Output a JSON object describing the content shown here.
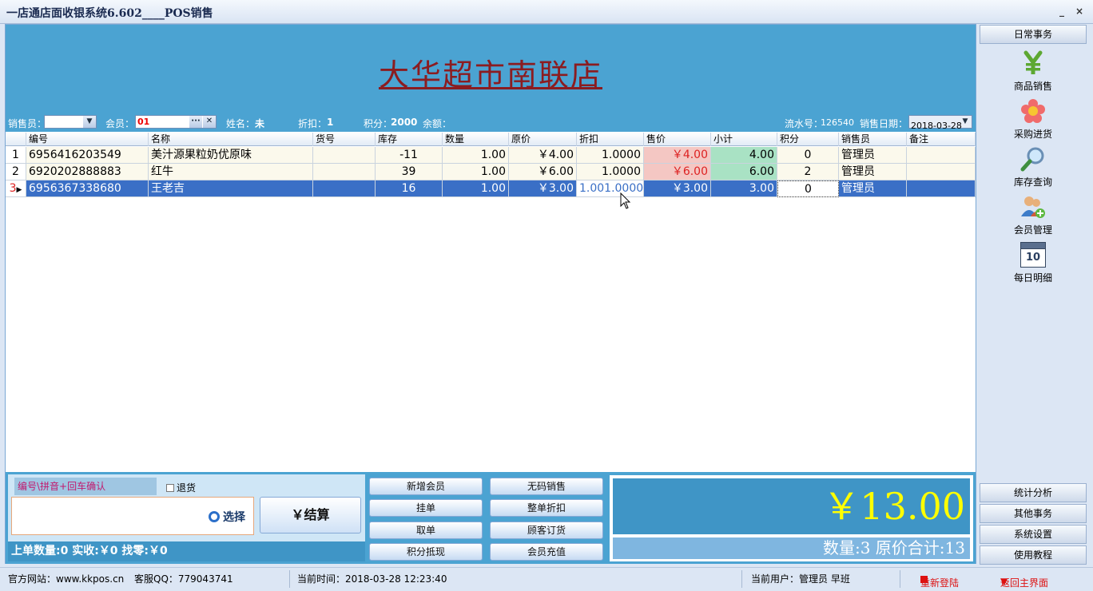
{
  "window": {
    "title": "一店通店面收银系统6.602____POS销售",
    "minimize": "_",
    "close": "×"
  },
  "banner": {
    "store_name": "大华超市南联店"
  },
  "info": {
    "salesman_label": "销售员：",
    "member_label": "会员：",
    "member_value": "01",
    "name_label": "姓名：",
    "name_value": "未",
    "discount_label": "折扣：",
    "discount_value": "1",
    "points_label": "积分：",
    "points_value": "2000",
    "balance_label": "余额：",
    "serial_label": "流水号：",
    "serial_value": "126540",
    "date_label": "销售日期：",
    "date_value": "2018-03-28"
  },
  "table": {
    "columns": [
      "编号",
      "名称",
      "货号",
      "库存",
      "数量",
      "原价",
      "折扣",
      "售价",
      "小计",
      "积分",
      "销售员",
      "备注"
    ],
    "rows": [
      {
        "idx": "1",
        "code": "6956416203549",
        "name": "美汁源果粒奶优原味",
        "sku": "",
        "stock": "-11",
        "qty": "1.00",
        "price": "￥4.00",
        "disc": "1.0000",
        "sale": "￥4.00",
        "subtotal": "4.00",
        "points": "0",
        "clerk": "管理员",
        "note": ""
      },
      {
        "idx": "2",
        "code": "6920202888883",
        "name": "红牛",
        "sku": "",
        "stock": "39",
        "qty": "1.00",
        "price": "￥6.00",
        "disc": "1.0000",
        "sale": "￥6.00",
        "subtotal": "6.00",
        "points": "2",
        "clerk": "管理员",
        "note": ""
      },
      {
        "idx": "3",
        "code": "6956367338680",
        "name": "王老吉",
        "sku": "",
        "stock": "16",
        "qty": "1.00",
        "price": "￥3.00",
        "disc": "1.001.0000",
        "sale": "￥3.00",
        "subtotal": "3.00",
        "points": "0",
        "clerk": "管理员",
        "note": ""
      }
    ]
  },
  "input": {
    "hint": "编号\\拼音+回车确认",
    "return_label": "退货",
    "select_label": "选择",
    "checkout_label": "￥结算"
  },
  "last": {
    "text": "上单数量:0   实收:￥0   找零:￥0"
  },
  "functions": [
    "新增会员",
    "无码销售",
    "挂单",
    "整单折扣",
    "取单",
    "顾客订货",
    "积分抵现",
    "会员充值"
  ],
  "total": {
    "amount": "￥13.00",
    "summary": "数量:3   原价合计:13"
  },
  "sidebar": {
    "top_header": "日常事务",
    "items": [
      "商品销售",
      "采购进货",
      "库存查询",
      "会员管理",
      "每日明细"
    ],
    "calendar_day": "10",
    "bottom_headers": [
      "统计分析",
      "其他事务",
      "系统设置",
      "使用教程"
    ]
  },
  "status": {
    "website": "官方网站：www.kkpos.cn",
    "qq": "客服QQ：779043741",
    "time": "当前时间：2018-03-28 12:23:40",
    "user": "当前用户：管理员 早班",
    "relogin": "重新登陆",
    "home": "返回主界面"
  },
  "colors": {
    "banner": "#4ba3d2",
    "selected_row": "#3a6fc6",
    "total_text": "#ffff00",
    "store_name": "#8b1c20"
  }
}
